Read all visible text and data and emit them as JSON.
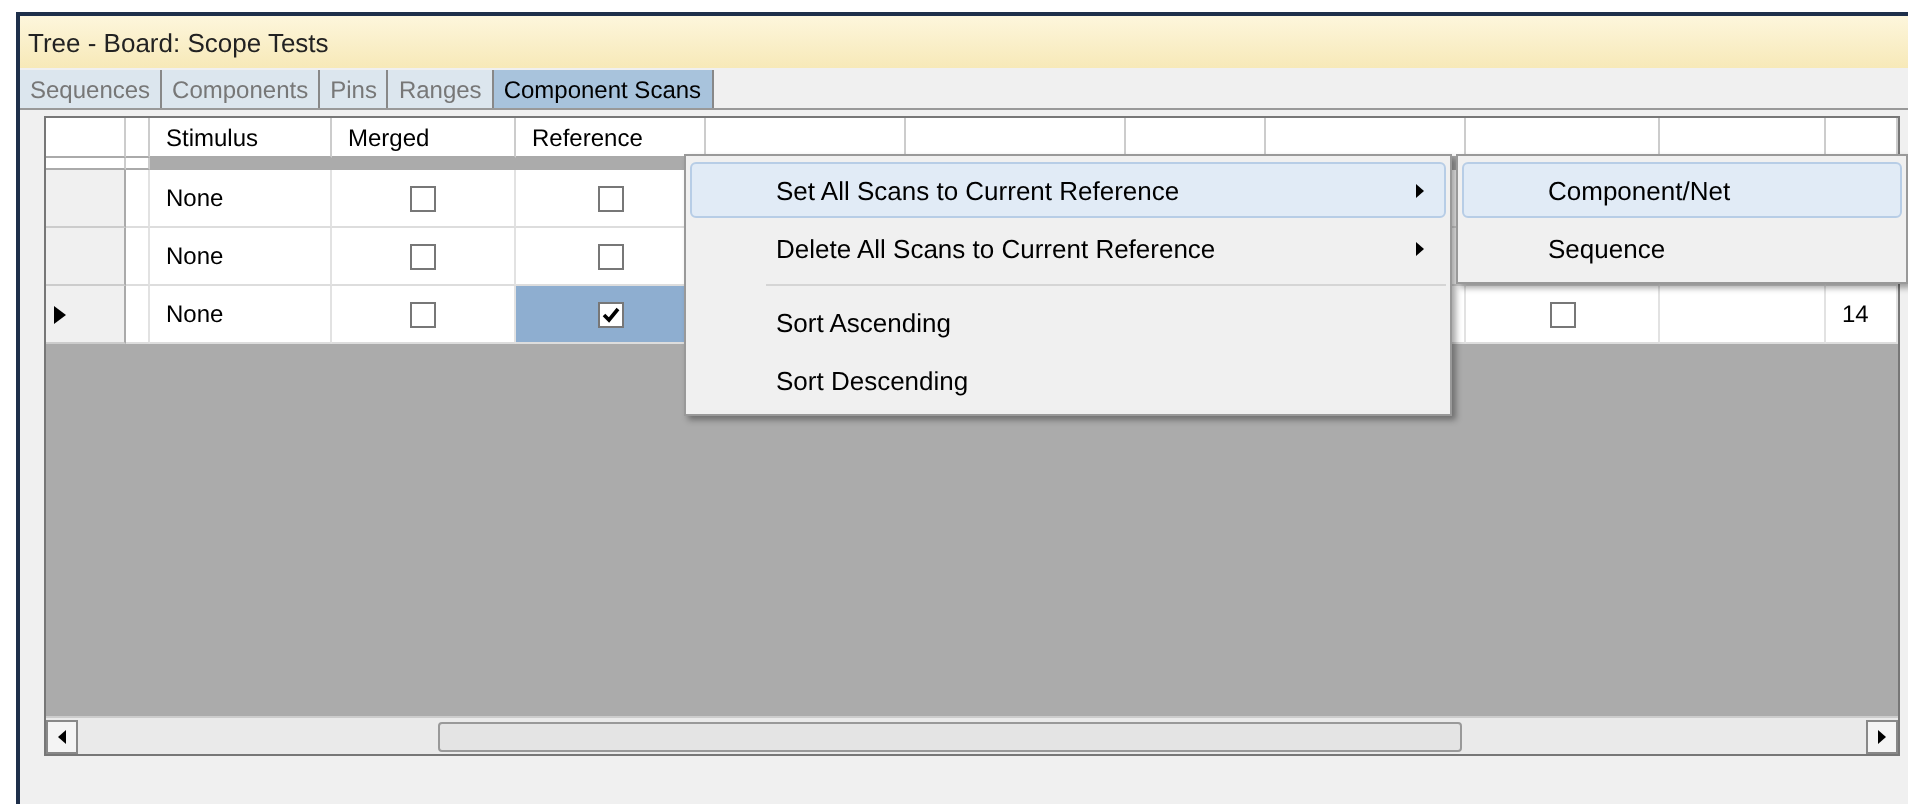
{
  "window": {
    "title": "Tree - Board: Scope Tests"
  },
  "tabs": [
    {
      "label": "Sequences",
      "selected": false
    },
    {
      "label": "Components",
      "selected": false
    },
    {
      "label": "Pins",
      "selected": false
    },
    {
      "label": "Ranges",
      "selected": false
    },
    {
      "label": "Component Scans",
      "selected": true
    }
  ],
  "table": {
    "columns": [
      "Stimulus",
      "Merged",
      "Reference"
    ],
    "rows": [
      {
        "current": false,
        "stimulus": "None",
        "merged": false,
        "reference": false,
        "reference_selected": false
      },
      {
        "current": false,
        "stimulus": "None",
        "merged": false,
        "reference": false,
        "reference_selected": false
      },
      {
        "current": true,
        "stimulus": "None",
        "merged": false,
        "reference": true,
        "reference_selected": true,
        "min_max": false,
        "column_10": "14"
      }
    ]
  },
  "context_menu": {
    "items": [
      {
        "kind": "item",
        "label": "Set All Scans to Current Reference",
        "submenu": true,
        "highlighted": true
      },
      {
        "kind": "item",
        "label": "Delete All Scans to Current Reference",
        "submenu": true,
        "highlighted": false
      },
      {
        "kind": "separator"
      },
      {
        "kind": "item",
        "label": "Sort Ascending",
        "submenu": false,
        "highlighted": false
      },
      {
        "kind": "item",
        "label": "Sort Descending",
        "submenu": false,
        "highlighted": false
      }
    ]
  },
  "submenu": {
    "items": [
      {
        "label": "Component/Net",
        "highlighted": true
      },
      {
        "label": "Sequence",
        "highlighted": false
      }
    ]
  }
}
